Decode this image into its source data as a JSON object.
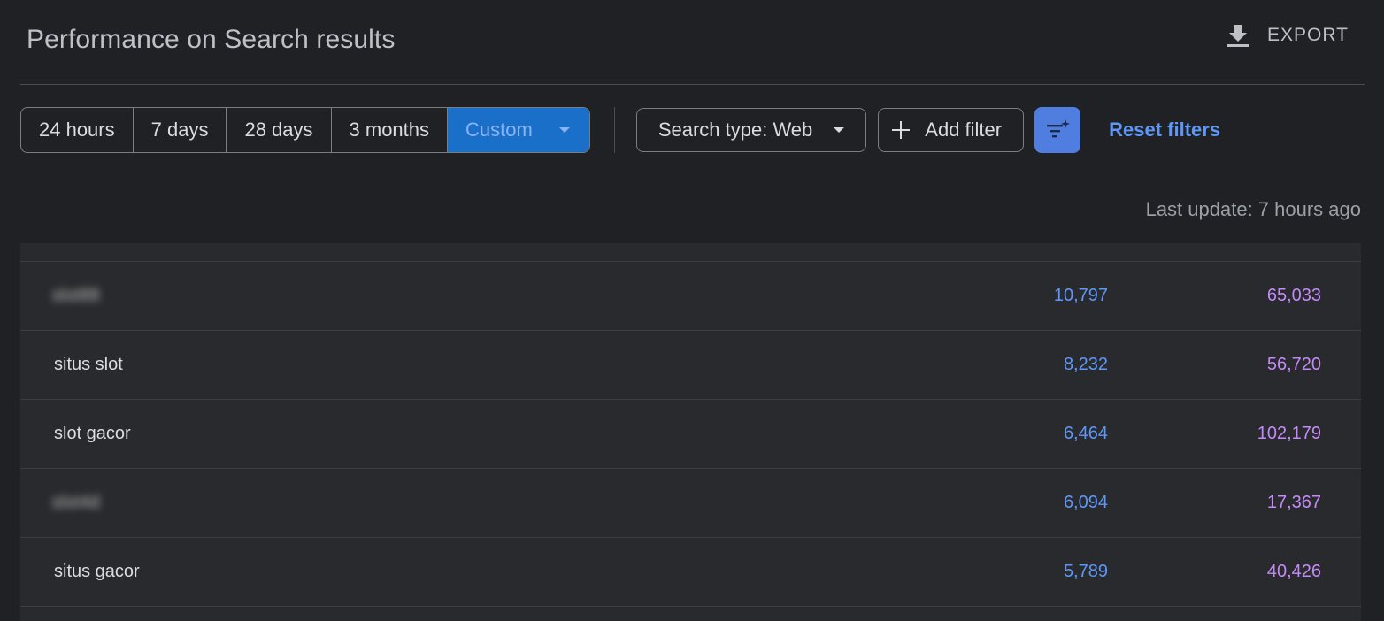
{
  "header": {
    "title": "Performance on Search results",
    "export_label": "EXPORT",
    "export_icon": "download-icon"
  },
  "date_range": {
    "options": [
      "24 hours",
      "7 days",
      "28 days",
      "3 months",
      "Custom"
    ],
    "selected": "Custom"
  },
  "filters": {
    "search_type_label": "Search type: Web",
    "add_filter_label": "Add filter",
    "reset_label": "Reset filters",
    "filter_icon": "filter-sparkle-icon"
  },
  "status": {
    "last_update": "Last update: 7 hours ago"
  },
  "colors": {
    "background": "#202124",
    "table_bg": "#292a2d",
    "accent_blue": "#5e97f6",
    "clicks_color": "#5e97f6",
    "impressions_color": "#c58af9",
    "active_segment": "#1a6fc9",
    "filter_button": "#4f7ee0"
  },
  "table": {
    "rows": [
      {
        "query": "slot88",
        "blurred": true,
        "clicks": "10,797",
        "impressions": "65,033"
      },
      {
        "query": "situs slot",
        "blurred": false,
        "clicks": "8,232",
        "impressions": "56,720"
      },
      {
        "query": "slot gacor",
        "blurred": false,
        "clicks": "6,464",
        "impressions": "102,179"
      },
      {
        "query": "slot4d",
        "blurred": true,
        "clicks": "6,094",
        "impressions": "17,367"
      },
      {
        "query": "situs gacor",
        "blurred": false,
        "clicks": "5,789",
        "impressions": "40,426"
      }
    ]
  }
}
